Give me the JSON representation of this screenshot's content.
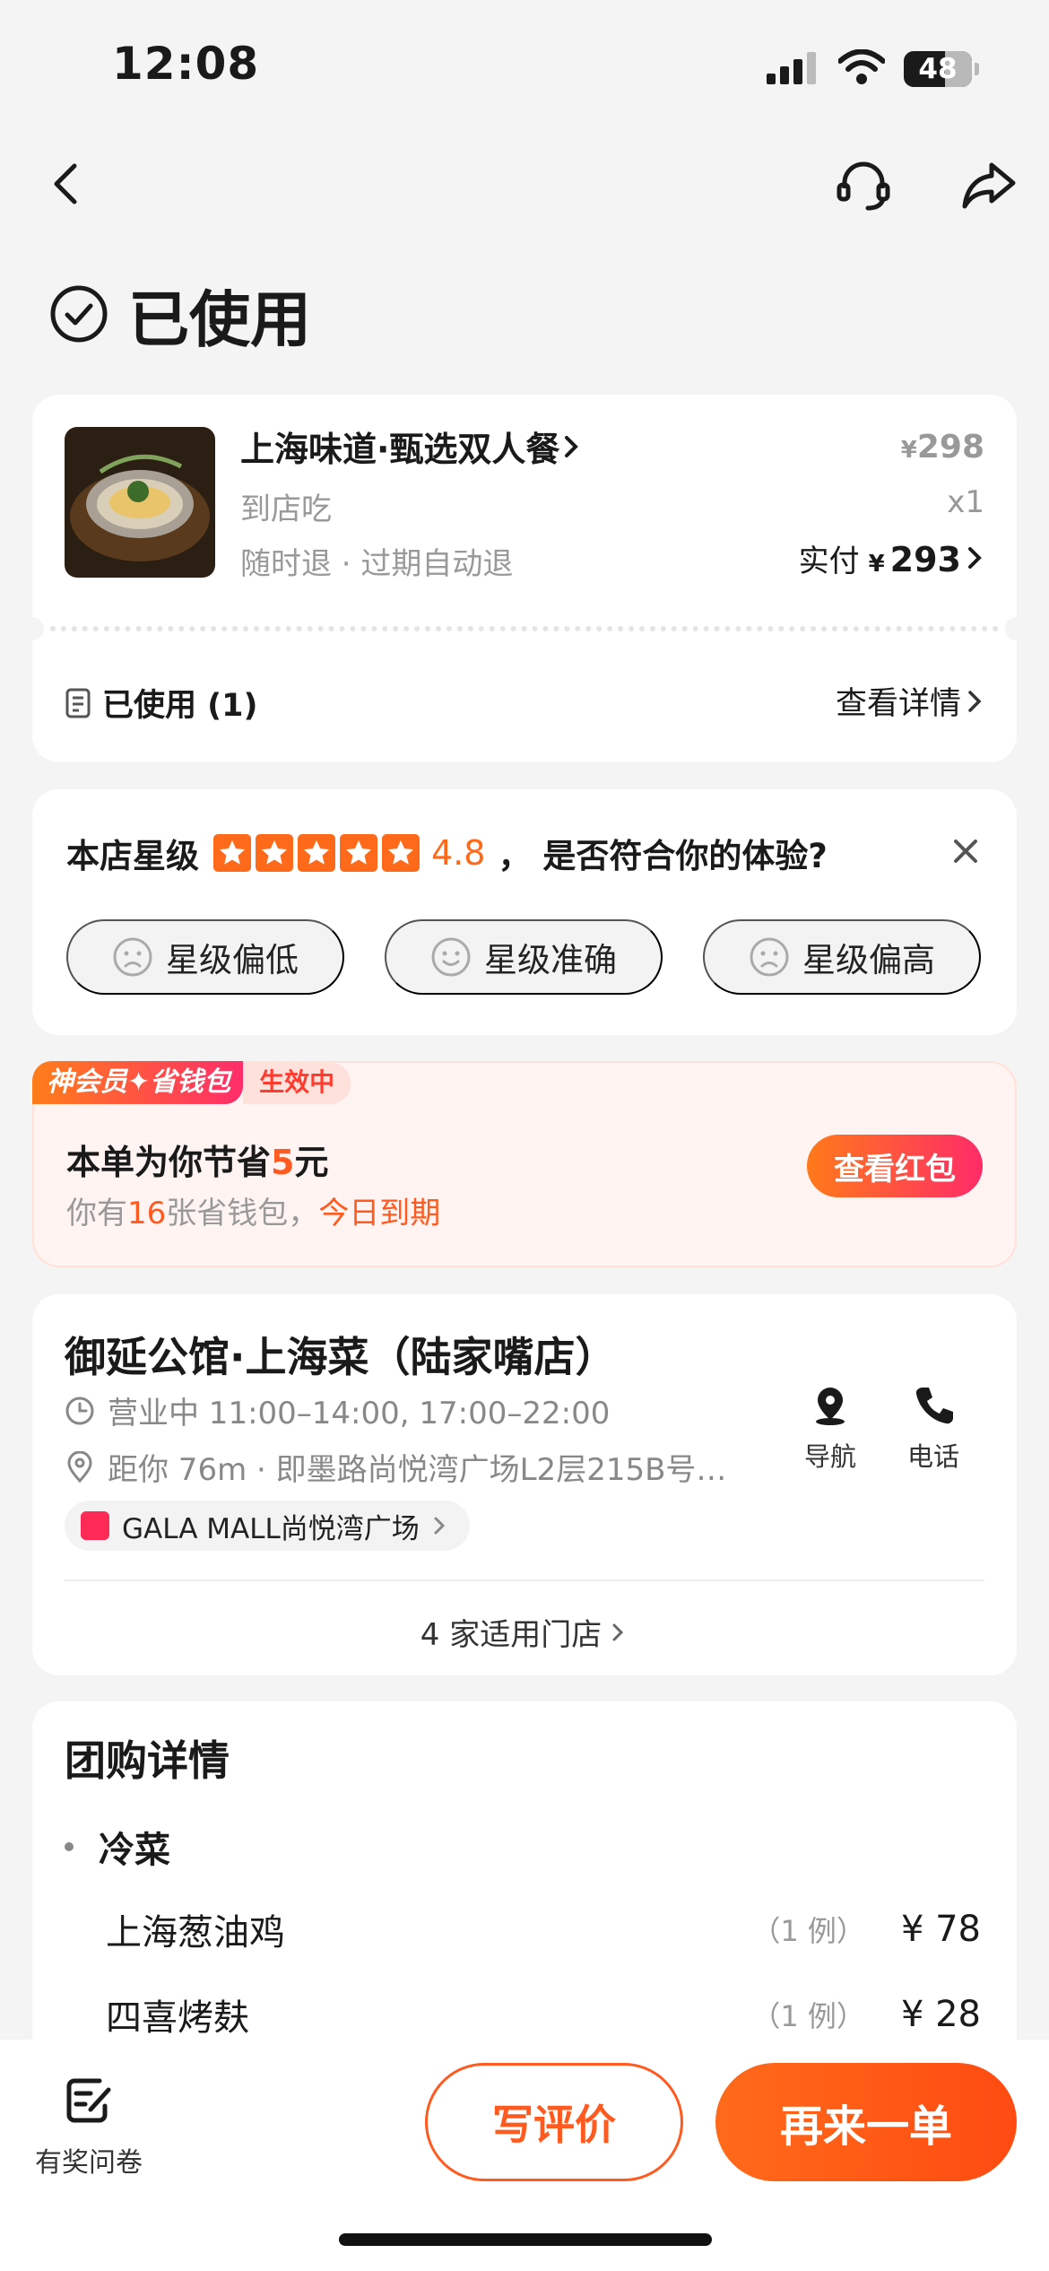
{
  "status_bar": {
    "time": "12:08",
    "battery": "48"
  },
  "order_status": "已使用",
  "product": {
    "name": "上海味道·甄选双人餐",
    "type": "到店吃",
    "refund_policy": "随时退 · 过期自动退",
    "price_symbol": "¥",
    "price": "298",
    "quantity": "x1",
    "paid_label": "实付",
    "paid_symbol": "¥",
    "paid_amount": "293",
    "used_label": "已使用 (1)",
    "view_details": "查看详情"
  },
  "rating": {
    "prefix": "本店星级",
    "score": "4.8",
    "stars": 5,
    "question": "， 是否符合你的体验?",
    "options": [
      "星级偏低",
      "星级准确",
      "星级偏高"
    ]
  },
  "member": {
    "badge": "神会员✦省钱包",
    "badge_status": "生效中",
    "title_prefix": "本单为你节省",
    "saved_amount": "5",
    "title_suffix": "元",
    "sub_prefix": "你有",
    "wallet_count": "16",
    "sub_mid": "张省钱包，",
    "sub_expire": "今日到期",
    "button": "查看红包"
  },
  "store": {
    "name": "御延公馆·上海菜（陆家嘴店）",
    "hours": "营业中 11:00–14:00, 17:00–22:00",
    "distance": "距你 76m · 即墨路尚悦湾广场L2层215B号…",
    "mall": "GALA MALL尚悦湾广场",
    "nav_label": "导航",
    "phone_label": "电话",
    "stores_link": "4 家适用门店"
  },
  "details": {
    "title": "团购详情",
    "category": "冷菜",
    "items": [
      {
        "name": "上海葱油鸡",
        "qty": "（1 例）",
        "price": "¥ 78"
      },
      {
        "name": "四喜烤麸",
        "qty": "（1 例）",
        "price": "¥ 28"
      }
    ]
  },
  "bottom": {
    "survey": "有奖问卷",
    "review": "写评价",
    "reorder": "再来一单"
  },
  "colors": {
    "accent": "#ff5a1f",
    "star": "#ff6a1a",
    "pink": "#ff2b68"
  }
}
